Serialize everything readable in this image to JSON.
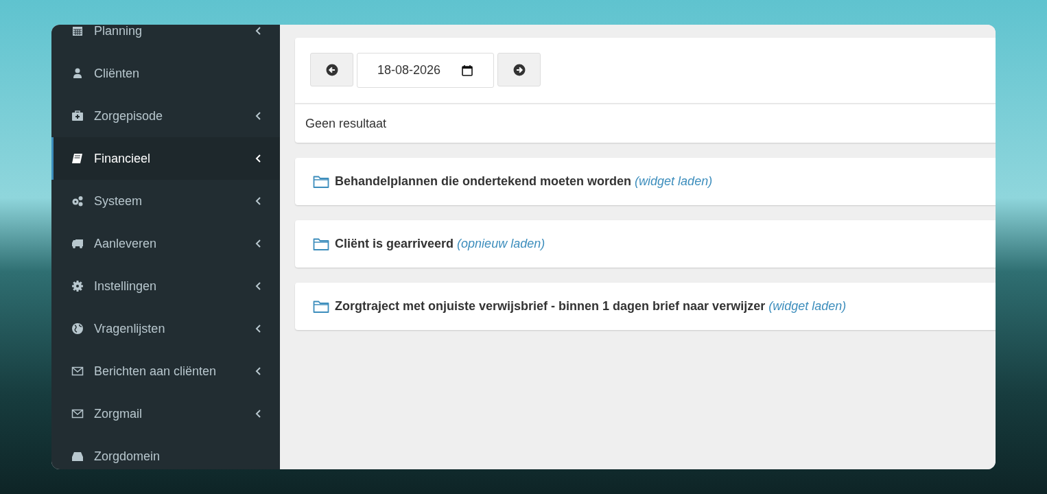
{
  "sidebar": {
    "items": [
      {
        "label": "Planning",
        "expandable": true,
        "selected": false
      },
      {
        "label": "Cliënten",
        "expandable": false,
        "selected": false
      },
      {
        "label": "Zorgepisode",
        "expandable": true,
        "selected": false
      },
      {
        "label": "Financieel",
        "expandable": true,
        "selected": true
      },
      {
        "label": "Systeem",
        "expandable": true,
        "selected": false
      },
      {
        "label": "Aanleveren",
        "expandable": true,
        "selected": false
      },
      {
        "label": "Instellingen",
        "expandable": true,
        "selected": false
      },
      {
        "label": "Vragenlijsten",
        "expandable": true,
        "selected": false
      },
      {
        "label": "Berichten aan cliënten",
        "expandable": true,
        "selected": false
      },
      {
        "label": "Zorgmail",
        "expandable": true,
        "selected": false
      },
      {
        "label": "Zorgdomein",
        "expandable": false,
        "selected": false
      }
    ]
  },
  "date_panel": {
    "date": "18-08-2026",
    "result": "Geen resultaat"
  },
  "widgets": [
    {
      "title": "Behandelplannen die ondertekend moeten worden",
      "link": "(widget laden)"
    },
    {
      "title": "Cliënt is gearriveerd",
      "link": "(opnieuw laden)"
    },
    {
      "title": "Zorgtraject met onjuiste verwijsbrief - binnen 1 dagen brief naar verwijzer",
      "link": "(widget laden)"
    }
  ]
}
